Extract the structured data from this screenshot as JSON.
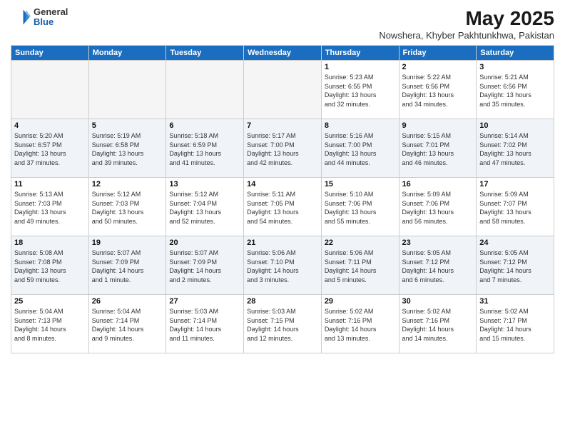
{
  "header": {
    "logo_general": "General",
    "logo_blue": "Blue",
    "title": "May 2025",
    "subtitle": "Nowshera, Khyber Pakhtunkhwa, Pakistan"
  },
  "weekdays": [
    "Sunday",
    "Monday",
    "Tuesday",
    "Wednesday",
    "Thursday",
    "Friday",
    "Saturday"
  ],
  "weeks": [
    [
      {
        "day": "",
        "info": ""
      },
      {
        "day": "",
        "info": ""
      },
      {
        "day": "",
        "info": ""
      },
      {
        "day": "",
        "info": ""
      },
      {
        "day": "1",
        "info": "Sunrise: 5:23 AM\nSunset: 6:55 PM\nDaylight: 13 hours\nand 32 minutes."
      },
      {
        "day": "2",
        "info": "Sunrise: 5:22 AM\nSunset: 6:56 PM\nDaylight: 13 hours\nand 34 minutes."
      },
      {
        "day": "3",
        "info": "Sunrise: 5:21 AM\nSunset: 6:56 PM\nDaylight: 13 hours\nand 35 minutes."
      }
    ],
    [
      {
        "day": "4",
        "info": "Sunrise: 5:20 AM\nSunset: 6:57 PM\nDaylight: 13 hours\nand 37 minutes."
      },
      {
        "day": "5",
        "info": "Sunrise: 5:19 AM\nSunset: 6:58 PM\nDaylight: 13 hours\nand 39 minutes."
      },
      {
        "day": "6",
        "info": "Sunrise: 5:18 AM\nSunset: 6:59 PM\nDaylight: 13 hours\nand 41 minutes."
      },
      {
        "day": "7",
        "info": "Sunrise: 5:17 AM\nSunset: 7:00 PM\nDaylight: 13 hours\nand 42 minutes."
      },
      {
        "day": "8",
        "info": "Sunrise: 5:16 AM\nSunset: 7:00 PM\nDaylight: 13 hours\nand 44 minutes."
      },
      {
        "day": "9",
        "info": "Sunrise: 5:15 AM\nSunset: 7:01 PM\nDaylight: 13 hours\nand 46 minutes."
      },
      {
        "day": "10",
        "info": "Sunrise: 5:14 AM\nSunset: 7:02 PM\nDaylight: 13 hours\nand 47 minutes."
      }
    ],
    [
      {
        "day": "11",
        "info": "Sunrise: 5:13 AM\nSunset: 7:03 PM\nDaylight: 13 hours\nand 49 minutes."
      },
      {
        "day": "12",
        "info": "Sunrise: 5:12 AM\nSunset: 7:03 PM\nDaylight: 13 hours\nand 50 minutes."
      },
      {
        "day": "13",
        "info": "Sunrise: 5:12 AM\nSunset: 7:04 PM\nDaylight: 13 hours\nand 52 minutes."
      },
      {
        "day": "14",
        "info": "Sunrise: 5:11 AM\nSunset: 7:05 PM\nDaylight: 13 hours\nand 54 minutes."
      },
      {
        "day": "15",
        "info": "Sunrise: 5:10 AM\nSunset: 7:06 PM\nDaylight: 13 hours\nand 55 minutes."
      },
      {
        "day": "16",
        "info": "Sunrise: 5:09 AM\nSunset: 7:06 PM\nDaylight: 13 hours\nand 56 minutes."
      },
      {
        "day": "17",
        "info": "Sunrise: 5:09 AM\nSunset: 7:07 PM\nDaylight: 13 hours\nand 58 minutes."
      }
    ],
    [
      {
        "day": "18",
        "info": "Sunrise: 5:08 AM\nSunset: 7:08 PM\nDaylight: 13 hours\nand 59 minutes."
      },
      {
        "day": "19",
        "info": "Sunrise: 5:07 AM\nSunset: 7:09 PM\nDaylight: 14 hours\nand 1 minute."
      },
      {
        "day": "20",
        "info": "Sunrise: 5:07 AM\nSunset: 7:09 PM\nDaylight: 14 hours\nand 2 minutes."
      },
      {
        "day": "21",
        "info": "Sunrise: 5:06 AM\nSunset: 7:10 PM\nDaylight: 14 hours\nand 3 minutes."
      },
      {
        "day": "22",
        "info": "Sunrise: 5:06 AM\nSunset: 7:11 PM\nDaylight: 14 hours\nand 5 minutes."
      },
      {
        "day": "23",
        "info": "Sunrise: 5:05 AM\nSunset: 7:12 PM\nDaylight: 14 hours\nand 6 minutes."
      },
      {
        "day": "24",
        "info": "Sunrise: 5:05 AM\nSunset: 7:12 PM\nDaylight: 14 hours\nand 7 minutes."
      }
    ],
    [
      {
        "day": "25",
        "info": "Sunrise: 5:04 AM\nSunset: 7:13 PM\nDaylight: 14 hours\nand 8 minutes."
      },
      {
        "day": "26",
        "info": "Sunrise: 5:04 AM\nSunset: 7:14 PM\nDaylight: 14 hours\nand 9 minutes."
      },
      {
        "day": "27",
        "info": "Sunrise: 5:03 AM\nSunset: 7:14 PM\nDaylight: 14 hours\nand 11 minutes."
      },
      {
        "day": "28",
        "info": "Sunrise: 5:03 AM\nSunset: 7:15 PM\nDaylight: 14 hours\nand 12 minutes."
      },
      {
        "day": "29",
        "info": "Sunrise: 5:02 AM\nSunset: 7:16 PM\nDaylight: 14 hours\nand 13 minutes."
      },
      {
        "day": "30",
        "info": "Sunrise: 5:02 AM\nSunset: 7:16 PM\nDaylight: 14 hours\nand 14 minutes."
      },
      {
        "day": "31",
        "info": "Sunrise: 5:02 AM\nSunset: 7:17 PM\nDaylight: 14 hours\nand 15 minutes."
      }
    ]
  ]
}
